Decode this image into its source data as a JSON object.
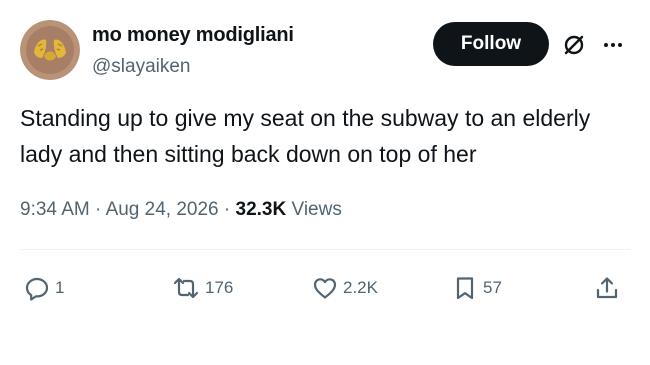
{
  "user": {
    "display_name": "mo money modigliani",
    "handle": "@slayaiken",
    "avatar_icon": "avatar-gold-hands"
  },
  "header": {
    "follow_label": "Follow",
    "grok_icon": "slashed-circle-icon",
    "more_icon": "more-dots-icon"
  },
  "tweet": {
    "text": "Standing up to give my seat on the subway to an elderly lady and then sitting back down on top of her"
  },
  "meta": {
    "time": "9:34 AM",
    "separator": "·",
    "date": "Aug 24, 2026",
    "views_count": "32.3K",
    "views_label": "Views"
  },
  "actions": {
    "reply_count": "1",
    "retweet_count": "176",
    "like_count": "2.2K",
    "bookmark_count": "57"
  },
  "colors": {
    "text_primary": "#0f1419",
    "text_secondary": "#536471",
    "follow_bg": "#0f1419",
    "divider": "#eff3f4"
  }
}
